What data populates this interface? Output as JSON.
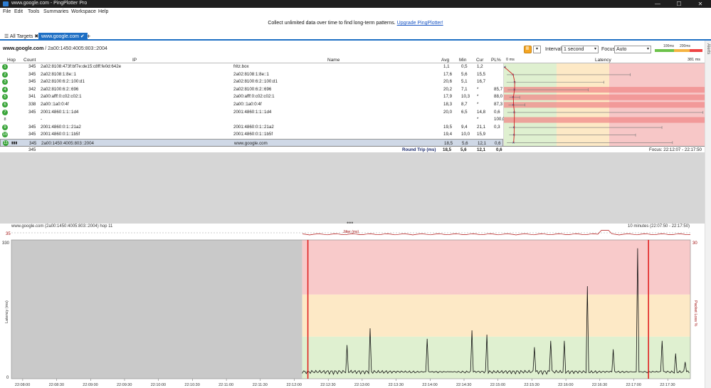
{
  "window": {
    "title": "www.google.com - PingPlotter Pro",
    "minimize": "—",
    "maximize": "☐",
    "close": "✕"
  },
  "menu": [
    "File",
    "Edit",
    "Tools",
    "Summaries",
    "Workspace",
    "Help"
  ],
  "promo": {
    "text": "Collect unlimited data over time to find long-term patterns.",
    "link": "Upgrade PingPlotter!"
  },
  "tabs": {
    "all_targets": "All Targets",
    "active": "www.google.com"
  },
  "breadcrumb": {
    "host": "www.google.com",
    "sep": " / ",
    "ip": "2a00:1450:4005:803::2004"
  },
  "controls": {
    "interval_label": "Interval",
    "interval_value": "1 second",
    "focus_label": "Focus",
    "focus_value": "Auto",
    "legend_100": "100ms",
    "legend_200": "200ms"
  },
  "colors": {
    "good": "#dff0d0",
    "warn": "#fde9c6",
    "bad": "#f7c7c7",
    "accent": "#1e6fc4",
    "red": "#e02020"
  },
  "table": {
    "headers": {
      "hop": "Hop",
      "count": "Count",
      "ip": "IP",
      "name": "Name",
      "avg": "Avg",
      "min": "Min",
      "cur": "Cur",
      "pl": "PL%",
      "zero": "0 ms",
      "latency": "Latency",
      "max": "381 ms"
    },
    "rows": [
      {
        "hop": "1",
        "count": "345",
        "ip": "2a02:8108:473f:bf7e:de15:c8ff:fe0d:642e",
        "name": "fritz.box",
        "avg": "1,1",
        "min": "0,5",
        "cur": "1,2",
        "pl": "",
        "plval": 0,
        "avgv": 1.1,
        "minv": 0.5,
        "maxv": 3
      },
      {
        "hop": "2",
        "count": "345",
        "ip": "2a02:8108:1:8e::1",
        "name": "2a02:8108:1:8e::1",
        "avg": "17,6",
        "min": "5,6",
        "cur": "15,5",
        "pl": "",
        "plval": 0,
        "avgv": 17.6,
        "minv": 5.6,
        "maxv": 240
      },
      {
        "hop": "3",
        "count": "345",
        "ip": "2a02:8100:6:2::100:d1",
        "name": "2a02:8100:6:2::100:d1",
        "avg": "20,6",
        "min": "5,1",
        "cur": "16,7",
        "pl": "",
        "plval": 0,
        "avgv": 20.6,
        "minv": 5.1,
        "maxv": 190
      },
      {
        "hop": "4",
        "count": "342",
        "ip": "2a02:8100:6:2::696",
        "name": "2a02:8100:6:2::696",
        "avg": "20,2",
        "min": "7,1",
        "cur": "*",
        "pl": "85,7",
        "plval": 85.7,
        "avgv": 20.2,
        "minv": 7.1,
        "maxv": 160
      },
      {
        "hop": "5",
        "count": "341",
        "ip": "2a00:afff:0:c02:c02:1",
        "name": "2a00:afff:0:c02:c02:1",
        "avg": "17,9",
        "min": "10,3",
        "cur": "*",
        "pl": "88,0",
        "plval": 88.0,
        "avgv": 17.9,
        "minv": 10.3,
        "maxv": 30
      },
      {
        "hop": "6",
        "count": "338",
        "ip": "2a00::1a0:0:4f",
        "name": "2a00::1a0:0:4f",
        "avg": "18,3",
        "min": "8,7",
        "cur": "*",
        "pl": "87,3",
        "plval": 87.3,
        "avgv": 18.3,
        "minv": 8.7,
        "maxv": 40
      },
      {
        "hop": "7",
        "count": "345",
        "ip": "2001:4860:1:1::1d4",
        "name": "2001:4860:1:1::1d4",
        "avg": "20,0",
        "min": "6,5",
        "cur": "14,8",
        "pl": "0,6",
        "plval": 0.6,
        "avgv": 20.0,
        "minv": 6.5,
        "maxv": 378
      },
      {
        "hop": "8",
        "count": "",
        "ip": "-",
        "name": "",
        "avg": "",
        "min": "",
        "cur": "*",
        "pl": "100,0",
        "plval": 100,
        "avgv": null,
        "minv": null,
        "maxv": null
      },
      {
        "hop": "9",
        "count": "345",
        "ip": "2001:4860:0:1::21a2",
        "name": "2001:4860:0:1::21a2",
        "avg": "19,5",
        "min": "9,4",
        "cur": "21,1",
        "pl": "0,3",
        "plval": 0.3,
        "avgv": 19.5,
        "minv": 9.4,
        "maxv": 300
      },
      {
        "hop": "10",
        "count": "345",
        "ip": "2001:4860:0:1::1b5f",
        "name": "2001:4860:0:1::1b5f",
        "avg": "19,4",
        "min": "10,0",
        "cur": "15,9",
        "pl": "",
        "plval": 0,
        "avgv": 19.4,
        "minv": 10.0,
        "maxv": 250
      },
      {
        "hop": "11",
        "count": "345",
        "ip": "2a00:1450:4005:803::2004",
        "name": "www.google.com",
        "avg": "18,5",
        "min": "5,6",
        "cur": "12,1",
        "pl": "0,6",
        "plval": 0.6,
        "avgv": 18.5,
        "minv": 5.6,
        "maxv": 320
      }
    ],
    "summary": {
      "count": "345",
      "label": "Round Trip (ms)",
      "avg": "18,5",
      "min": "5,6",
      "cur": "12,1",
      "pl": "0,6",
      "focus": "Focus: 22:12:07 - 22:17:50"
    }
  },
  "graph": {
    "header_left": "www.google.com (2a00:1450:4005:803::2004) hop 11",
    "header_right": "10 minutes (22:07:50 - 22:17:50)",
    "jitter_label": "Jitter (ms)",
    "jitter_max": "35",
    "y_max_left": "330",
    "y_min_left": "0",
    "y_max_right": "30",
    "y_label_left": "Latency (ms)",
    "y_label_right": "Packet Loss %",
    "x_ticks": [
      "22:08:00",
      "22:08:30",
      "22:09:00",
      "22:09:30",
      "22:10:00",
      "22:10:30",
      "22:11:00",
      "22:11:30",
      "22:12:00",
      "22:12:30",
      "22:13:00",
      "22:13:30",
      "22:14:00",
      "22:14:30",
      "22:15:00",
      "22:15:30",
      "22:16:00",
      "22:16:30",
      "22:17:00",
      "22:17:30"
    ]
  }
}
